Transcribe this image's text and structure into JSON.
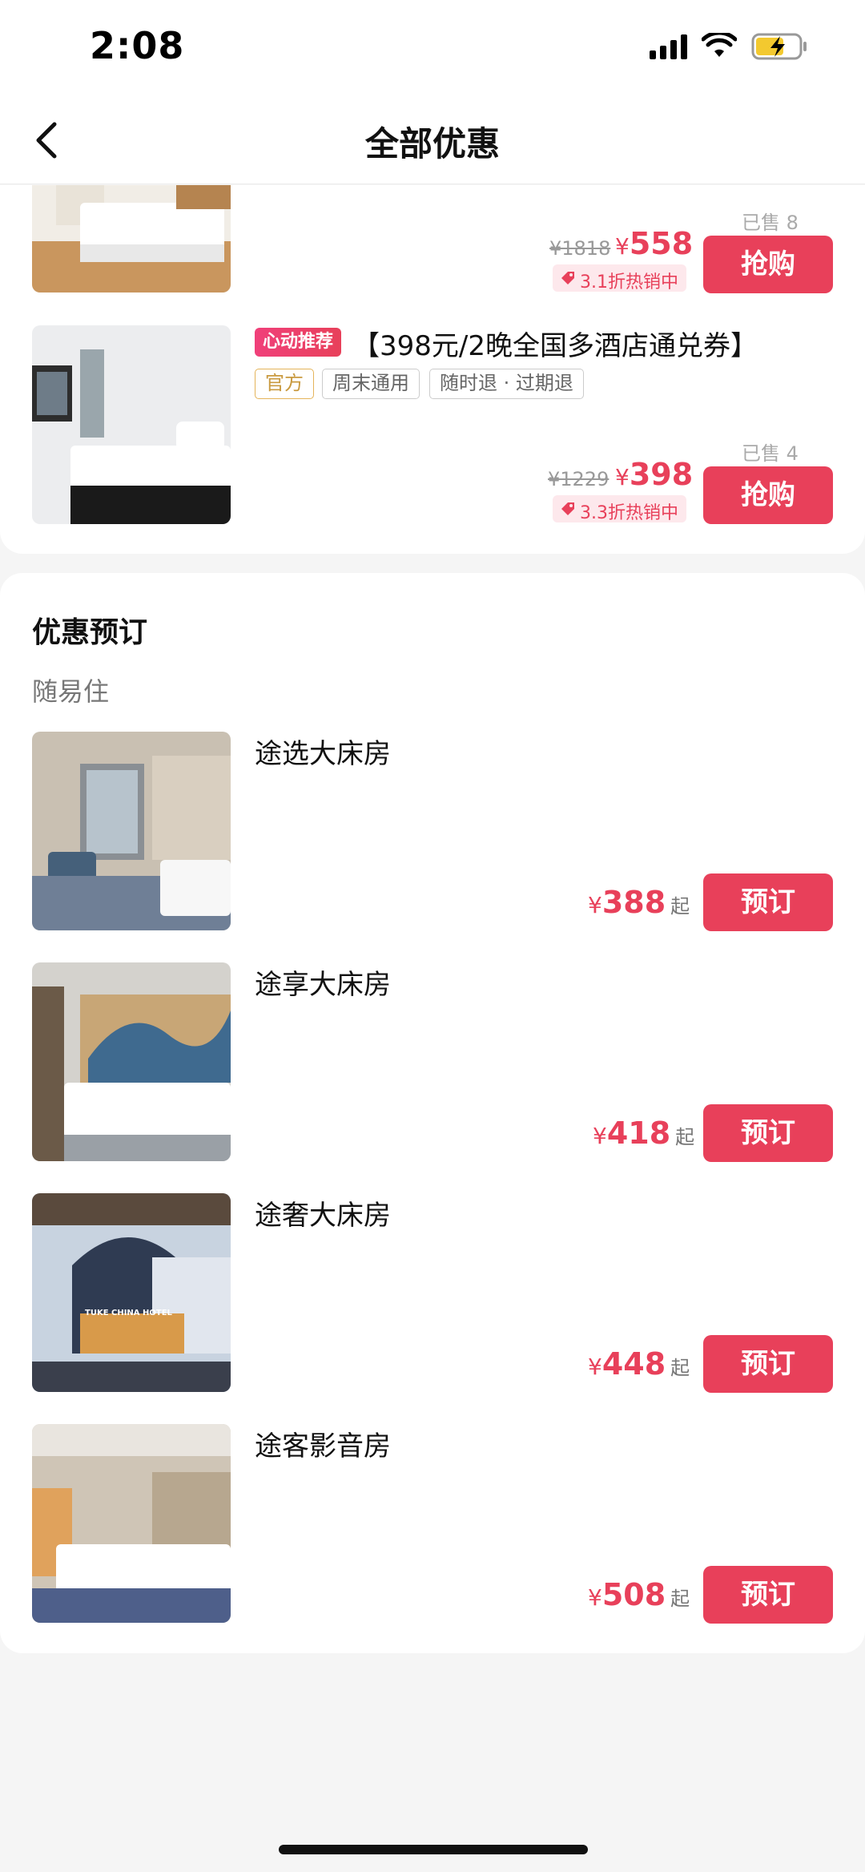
{
  "status_bar": {
    "time": "2:08"
  },
  "nav": {
    "title": "全部优惠"
  },
  "deals": [
    {
      "orig_price": "¥1818",
      "currency": "¥",
      "price": "558",
      "discount": "3.1折热销中",
      "sold": "已售 8",
      "button": "抢购"
    },
    {
      "badge": "心动推荐",
      "title": "【398元/2晚全国多酒店通兑券】",
      "tags": [
        "官方",
        "周末通用",
        "随时退 · 过期退"
      ],
      "orig_price": "¥1229",
      "currency": "¥",
      "price": "398",
      "discount": "3.3折热销中",
      "sold": "已售 4",
      "button": "抢购"
    }
  ],
  "booking": {
    "section_title": "优惠预订",
    "brand": "随易住",
    "rooms": [
      {
        "name": "途选大床房",
        "currency": "¥",
        "price": "388",
        "suffix": "起",
        "button": "预订"
      },
      {
        "name": "途享大床房",
        "currency": "¥",
        "price": "418",
        "suffix": "起",
        "button": "预订"
      },
      {
        "name": "途奢大床房",
        "currency": "¥",
        "price": "448",
        "suffix": "起",
        "button": "预订",
        "image_sign": "TUKE CHINA HOTEL"
      },
      {
        "name": "途客影音房",
        "currency": "¥",
        "price": "508",
        "suffix": "起",
        "button": "预订"
      }
    ]
  },
  "colors": {
    "accent": "#e8405a",
    "badge_bg": "#fde8ec",
    "official": "#c99a40"
  }
}
